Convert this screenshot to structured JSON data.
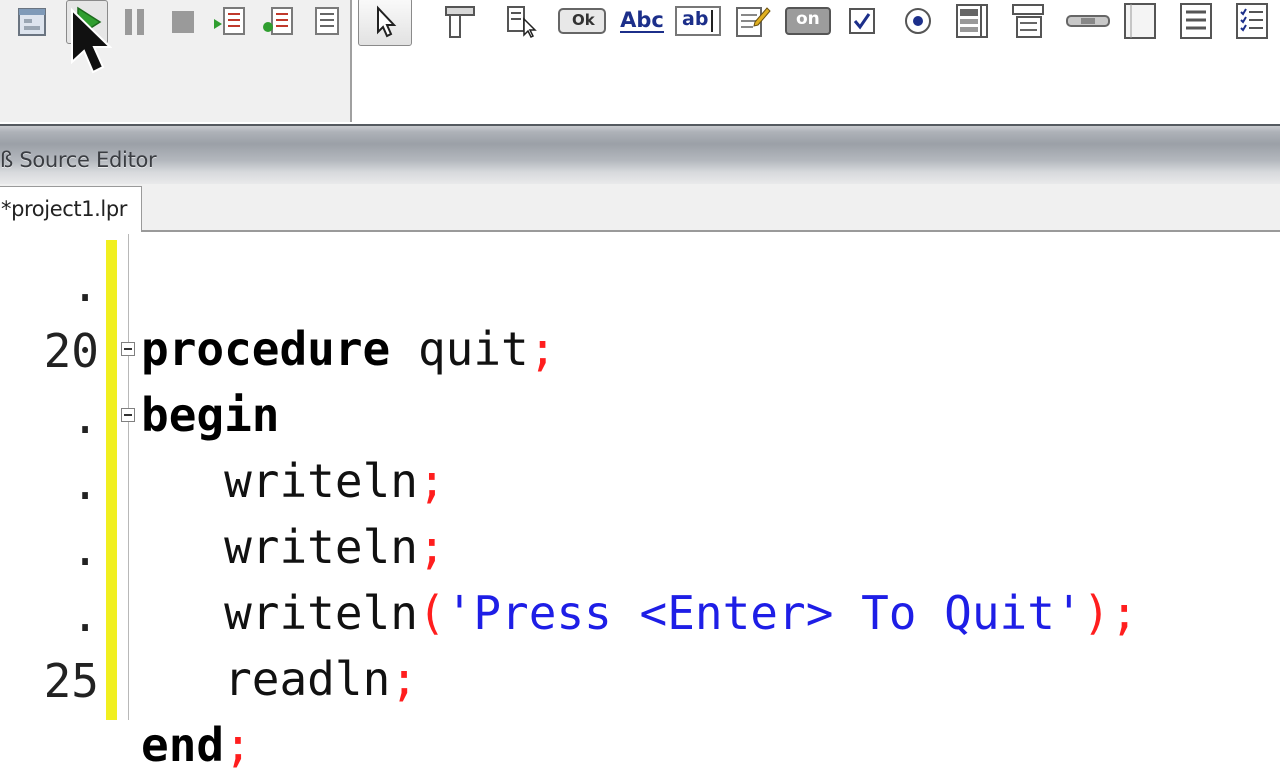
{
  "editor": {
    "title": "Source Editor",
    "title_prefix": "ß",
    "active_tab": "project1.lpr",
    "tab_prefix": "*"
  },
  "toolbar": {
    "left_icons": [
      "new-form-icon",
      "run-icon",
      "pause-icon",
      "stop-icon",
      "step-into-icon",
      "step-over-icon",
      "run-to-cursor-icon"
    ],
    "component_labels": {
      "button_icon_text": "Ok",
      "label_icon_text": "Abc",
      "edit_icon_text": "ab",
      "toggle_icon_text": "on"
    }
  },
  "code": {
    "lines": [
      {
        "num": ".",
        "indent": "",
        "tokens": []
      },
      {
        "num": "20",
        "indent": "",
        "tokens": [
          {
            "t": "procedure",
            "c": "kw"
          },
          {
            "t": " quit",
            "c": "id"
          },
          {
            "t": ";",
            "c": "sym"
          }
        ]
      },
      {
        "num": ".",
        "indent": "",
        "tokens": [
          {
            "t": "begin",
            "c": "kw"
          }
        ]
      },
      {
        "num": ".",
        "indent": "   ",
        "tokens": [
          {
            "t": "writeln",
            "c": "id"
          },
          {
            "t": ";",
            "c": "sym"
          }
        ]
      },
      {
        "num": ".",
        "indent": "   ",
        "tokens": [
          {
            "t": "writeln",
            "c": "id"
          },
          {
            "t": ";",
            "c": "sym"
          }
        ]
      },
      {
        "num": ".",
        "indent": "   ",
        "tokens": [
          {
            "t": "writeln",
            "c": "id"
          },
          {
            "t": "(",
            "c": "sym"
          },
          {
            "t": "'Press <Enter> To Quit'",
            "c": "str"
          },
          {
            "t": ")",
            "c": "sym"
          },
          {
            "t": ";",
            "c": "sym"
          }
        ]
      },
      {
        "num": "25",
        "indent": "   ",
        "tokens": [
          {
            "t": "readln",
            "c": "id"
          },
          {
            "t": ";",
            "c": "sym"
          }
        ]
      },
      {
        "num": "",
        "indent": "",
        "tokens": [
          {
            "t": "end",
            "c": "kw"
          },
          {
            "t": ";",
            "c": "sym"
          }
        ]
      }
    ]
  },
  "colors": {
    "keyword": "#000000",
    "symbol": "#ff1e1e",
    "string": "#1e1ee6",
    "gutter_marker": "#f1ef1f"
  }
}
